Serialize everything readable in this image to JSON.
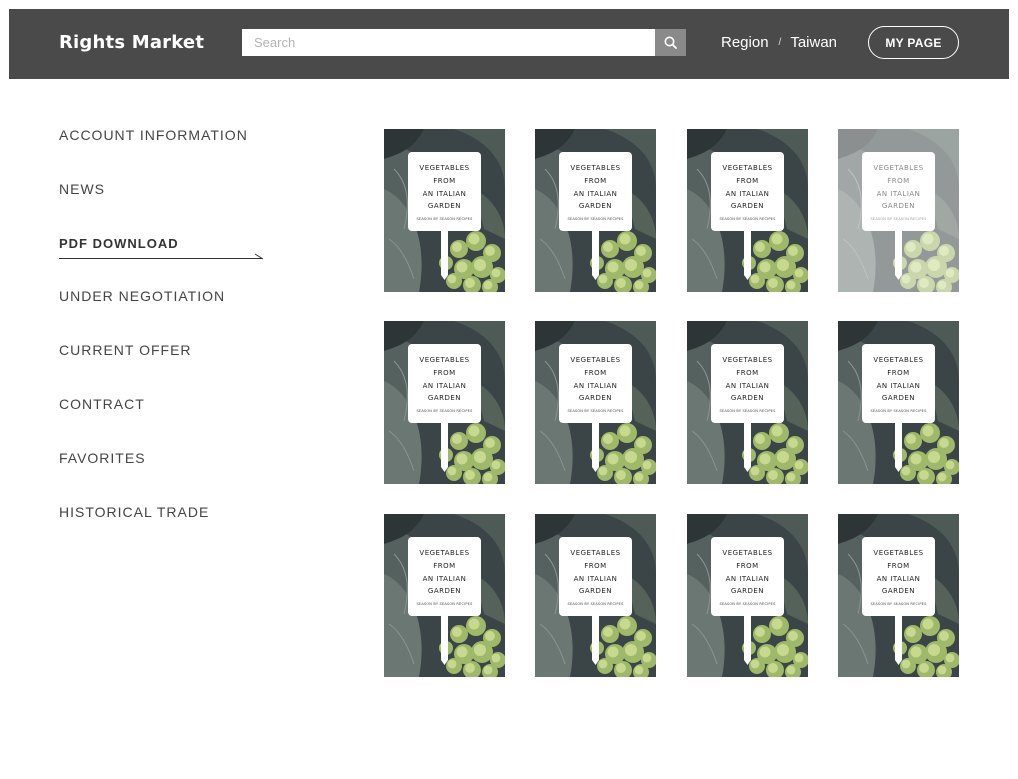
{
  "header": {
    "logo": "Rights Market",
    "search_placeholder": "Search",
    "region_label": "Region",
    "region_sep": "/",
    "region_value": "Taiwan",
    "mypage_label": "MY PAGE"
  },
  "sidebar": {
    "items": [
      {
        "label": "ACCOUNT INFORMATION",
        "active": false
      },
      {
        "label": "NEWS",
        "active": false
      },
      {
        "label": "PDF DOWNLOAD",
        "active": true
      },
      {
        "label": "UNDER NEGOTIATION",
        "active": false
      },
      {
        "label": "CURRENT OFFER",
        "active": false
      },
      {
        "label": "CONTRACT",
        "active": false
      },
      {
        "label": "FAVORITES",
        "active": false
      },
      {
        "label": "HISTORICAL TRADE",
        "active": false
      }
    ]
  },
  "book": {
    "title_lines": [
      "VEGETABLES",
      "FROM",
      "AN ITALIAN",
      "GARDEN"
    ],
    "subtitle": "SEASON BY SEASON RECIPES"
  },
  "grid": {
    "cards": [
      {
        "faded": false
      },
      {
        "faded": false
      },
      {
        "faded": false
      },
      {
        "faded": true
      },
      {
        "faded": false
      },
      {
        "faded": false
      },
      {
        "faded": false
      },
      {
        "faded": false
      },
      {
        "faded": false
      },
      {
        "faded": false
      },
      {
        "faded": false
      },
      {
        "faded": false
      }
    ]
  },
  "colors": {
    "header_bg": "#4a4a4a",
    "search_button_bg": "#8a8a8a",
    "text": "#444444"
  },
  "icons": {
    "search": "search-icon",
    "active_arrow": "arrow-right-icon"
  }
}
